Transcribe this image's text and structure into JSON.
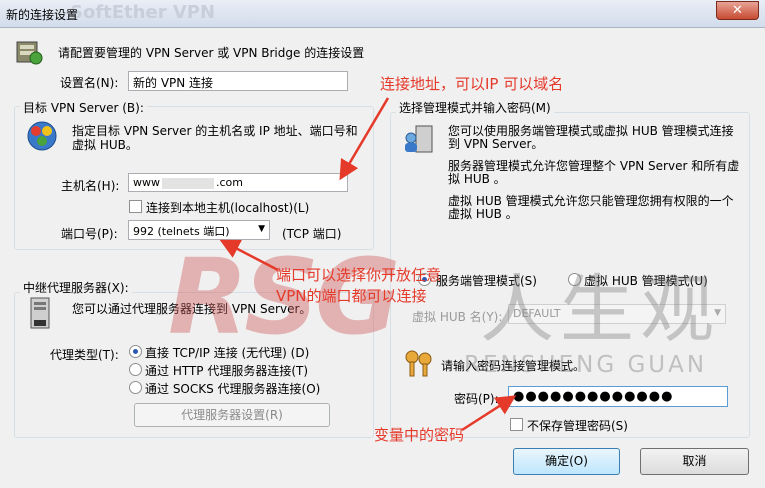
{
  "window": {
    "title": "新的连接设置",
    "background_title": "SoftEther VPN",
    "close_label": "✕"
  },
  "header": {
    "text": "请配置要管理的 VPN Server 或 VPN Bridge 的连接设置"
  },
  "setting_name": {
    "label": "设置名(N):",
    "value": "新的 VPN 连接"
  },
  "target_group": {
    "legend": "目标 VPN Server (B):",
    "description_line1": "指定目标 VPN Server 的主机名或 IP 地址、端口号和",
    "description_line2": "虚拟 HUB。",
    "host_label": "主机名(H):",
    "host_value_prefix": "www",
    "host_value_suffix": ".com",
    "localhost_checkbox_label": "连接到本地主机(localhost)(L)",
    "port_label": "端口号(P):",
    "port_value": "992 (telnets 端口)",
    "port_suffix": "(TCP 端口)"
  },
  "proxy_group": {
    "legend": "中继代理服务器(X):",
    "description": "您可以通过代理服务器连接到 VPN Server。",
    "type_label": "代理类型(T):",
    "options": [
      "直接 TCP/IP 连接 (无代理) (D)",
      "通过 HTTP 代理服务器连接(T)",
      "通过 SOCKS 代理服务器连接(O)"
    ],
    "selected_index": 0,
    "settings_button": "代理服务器设置(R)"
  },
  "admin_group": {
    "legend": "选择管理模式并输入密码(M)",
    "para1_line1": "您可以使用服务端管理模式或虚拟 HUB 管理模式连接",
    "para1_line2": "到 VPN Server。",
    "para2_line1": "服务器管理模式允许您管理整个 VPN Server 和所有虚",
    "para2_line2": "拟 HUB 。",
    "para3_line1": "虚拟 HUB 管理模式允许您只能管理您拥有权限的一个",
    "para3_line2": "虚拟 HUB 。",
    "server_mode_label": "服务端管理模式(S)",
    "hub_mode_label": "虚拟 HUB 管理模式(U)",
    "selected_mode": "server",
    "hub_name_label": "虚拟 HUB 名(Y):",
    "hub_name_value": "DEFAULT",
    "password_prompt": "请输入密码连接管理模式。",
    "password_label": "密码(P):",
    "password_value": "●●●●●●●●●●●●●",
    "no_save_label": "不保存管理密码(S)"
  },
  "buttons": {
    "ok": "确定(O)",
    "cancel": "取消"
  },
  "annotations": {
    "address_note": "连接地址，可以IP 可以域名",
    "port_note_line1": "端口可以选择你开放任意",
    "port_note_line2": "VPN的端口都可以连接",
    "password_note": "变量中的密码"
  },
  "watermark": {
    "brand": "RSG",
    "chinese": "人生观",
    "english": "RENSHENG GUAN"
  },
  "colors": {
    "annotation_red": "#e5392a",
    "title_gradient_top": "#e9eef6",
    "primary_button": "#bee6fd"
  }
}
